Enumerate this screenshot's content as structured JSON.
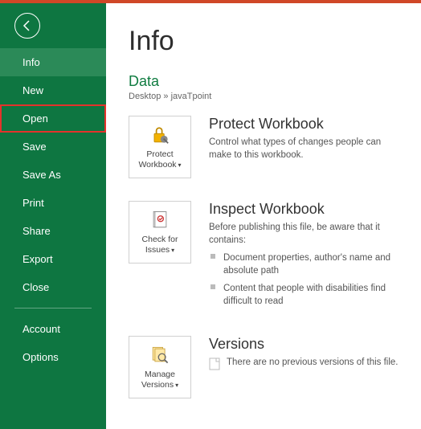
{
  "sidebar": {
    "items": [
      {
        "label": "Info",
        "active": true
      },
      {
        "label": "New"
      },
      {
        "label": "Open",
        "highlight": true
      },
      {
        "label": "Save"
      },
      {
        "label": "Save As"
      },
      {
        "label": "Print"
      },
      {
        "label": "Share"
      },
      {
        "label": "Export"
      },
      {
        "label": "Close"
      }
    ],
    "footer": [
      {
        "label": "Account"
      },
      {
        "label": "Options"
      }
    ]
  },
  "page": {
    "title": "Info"
  },
  "document": {
    "name": "Data",
    "path": "Desktop » javaTpoint"
  },
  "protect": {
    "tile": "Protect Workbook",
    "heading": "Protect Workbook",
    "text": "Control what types of changes people can make to this workbook."
  },
  "inspect": {
    "tile": "Check for Issues",
    "heading": "Inspect Workbook",
    "lead": "Before publishing this file, be aware that it contains:",
    "items": [
      "Document properties, author's name and absolute path",
      "Content that people with disabilities find difficult to read"
    ]
  },
  "versions": {
    "tile": "Manage Versions",
    "heading": "Versions",
    "text": "There are no previous versions of this file."
  }
}
